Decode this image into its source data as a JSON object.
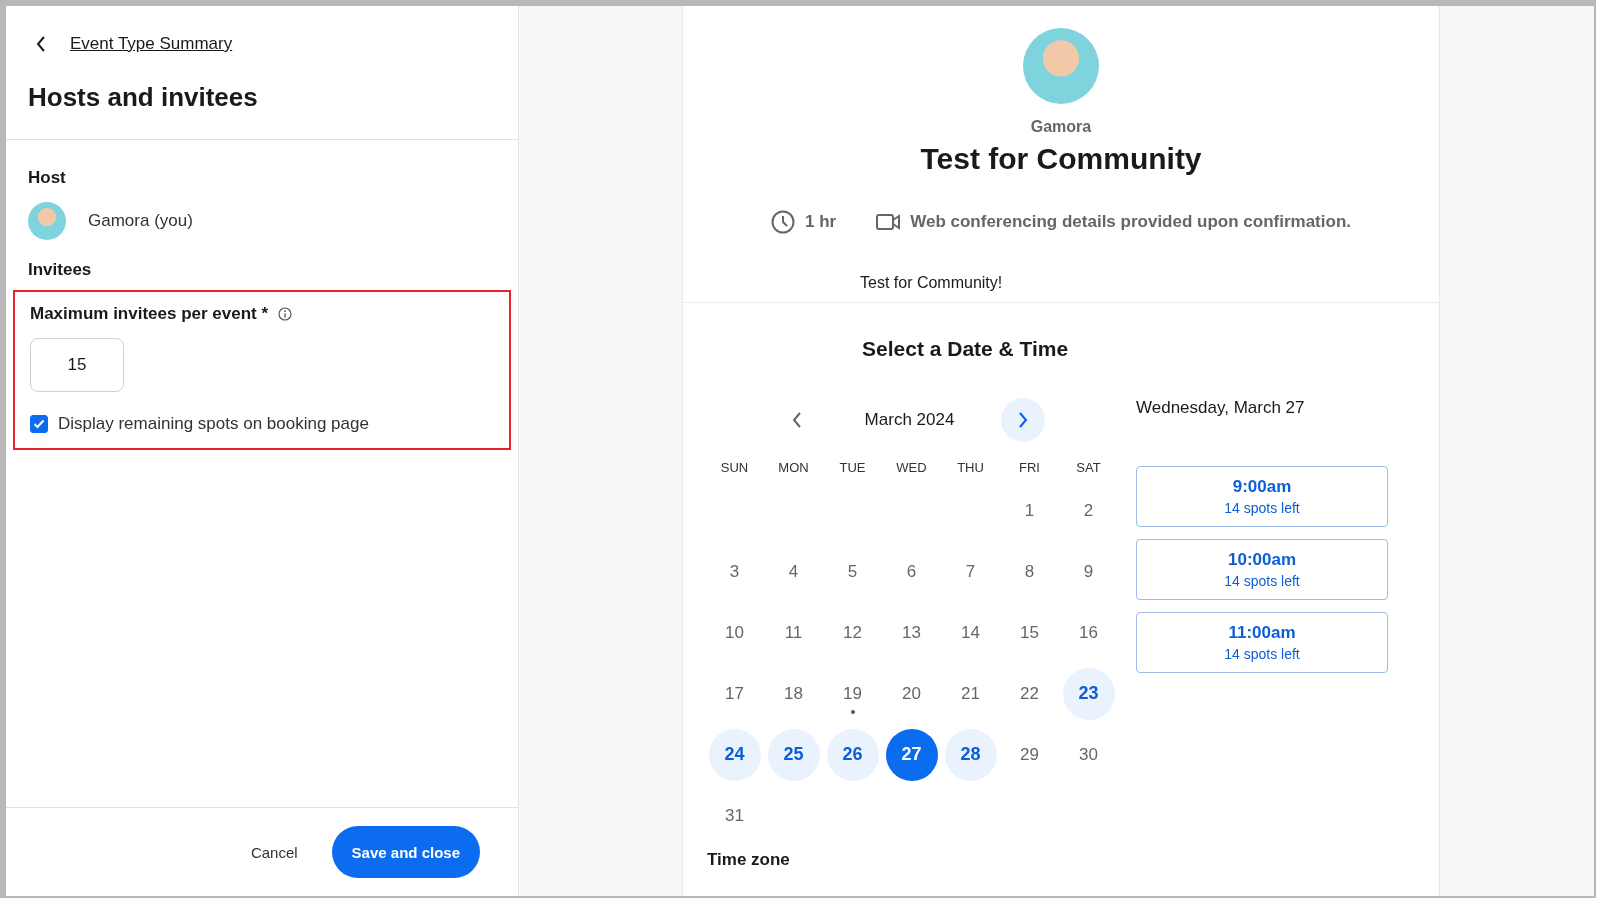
{
  "editor": {
    "back_link": "Event Type Summary",
    "title": "Hosts and invitees",
    "host_heading": "Host",
    "host_name": "Gamora (you)",
    "invitees_heading": "Invitees",
    "highlighted": true,
    "max_label": "Maximum invitees per event *",
    "max_value": "15",
    "display_remaining": {
      "label": "Display remaining spots on booking page",
      "checked": true
    },
    "cancel": "Cancel",
    "save": "Save and close"
  },
  "booking": {
    "host_name": "Gamora",
    "event_title": "Test for Community",
    "duration": "1 hr",
    "location": "Web conferencing details provided upon confirmation.",
    "description": "Test for Community!",
    "heading": "Select a Date & Time",
    "month": "March 2024",
    "weekdays": [
      "SUN",
      "MON",
      "TUE",
      "WED",
      "THU",
      "FRI",
      "SAT"
    ],
    "weeks": [
      {
        "kind": "first",
        "days": [
          {
            "day": "1",
            "available": false,
            "selected": false,
            "today": false
          },
          {
            "day": "2",
            "available": false,
            "selected": false,
            "today": false
          }
        ]
      },
      {
        "kind": "middle",
        "days": [
          {
            "day": "3",
            "available": false,
            "selected": false,
            "today": false
          },
          {
            "day": "4",
            "available": false,
            "selected": false,
            "today": false
          },
          {
            "day": "5",
            "available": false,
            "selected": false,
            "today": false
          },
          {
            "day": "6",
            "available": false,
            "selected": false,
            "today": false
          },
          {
            "day": "7",
            "available": false,
            "selected": false,
            "today": false
          },
          {
            "day": "8",
            "available": false,
            "selected": false,
            "today": false
          },
          {
            "day": "9",
            "available": false,
            "selected": false,
            "today": false
          }
        ]
      },
      {
        "kind": "middle",
        "days": [
          {
            "day": "10",
            "available": false,
            "selected": false,
            "today": false
          },
          {
            "day": "11",
            "available": false,
            "selected": false,
            "today": false
          },
          {
            "day": "12",
            "available": false,
            "selected": false,
            "today": false
          },
          {
            "day": "13",
            "available": false,
            "selected": false,
            "today": false
          },
          {
            "day": "14",
            "available": false,
            "selected": false,
            "today": false
          },
          {
            "day": "15",
            "available": false,
            "selected": false,
            "today": false
          },
          {
            "day": "16",
            "available": false,
            "selected": false,
            "today": false
          }
        ]
      },
      {
        "kind": "middle",
        "days": [
          {
            "day": "17",
            "available": false,
            "selected": false,
            "today": false
          },
          {
            "day": "18",
            "available": false,
            "selected": false,
            "today": false
          },
          {
            "day": "19",
            "available": false,
            "selected": false,
            "today": true
          },
          {
            "day": "20",
            "available": false,
            "selected": false,
            "today": false
          },
          {
            "day": "21",
            "available": false,
            "selected": false,
            "today": false
          },
          {
            "day": "22",
            "available": false,
            "selected": false,
            "today": false
          },
          {
            "day": "23",
            "available": true,
            "selected": false,
            "today": false
          }
        ]
      },
      {
        "kind": "middle",
        "days": [
          {
            "day": "24",
            "available": true,
            "selected": false,
            "today": false
          },
          {
            "day": "25",
            "available": true,
            "selected": false,
            "today": false
          },
          {
            "day": "26",
            "available": true,
            "selected": false,
            "today": false
          },
          {
            "day": "27",
            "available": true,
            "selected": true,
            "today": false
          },
          {
            "day": "28",
            "available": true,
            "selected": false,
            "today": false
          },
          {
            "day": "29",
            "available": false,
            "selected": false,
            "today": false
          },
          {
            "day": "30",
            "available": false,
            "selected": false,
            "today": false
          }
        ]
      },
      {
        "kind": "last",
        "days": [
          {
            "day": "31",
            "available": false,
            "selected": false,
            "today": false
          }
        ]
      }
    ],
    "selected_date": "Wednesday, March 27",
    "slots": [
      {
        "time": "9:00am",
        "spots": "14 spots left"
      },
      {
        "time": "10:00am",
        "spots": "14 spots left"
      },
      {
        "time": "11:00am",
        "spots": "14 spots left"
      }
    ],
    "timezone_heading": "Time zone"
  }
}
